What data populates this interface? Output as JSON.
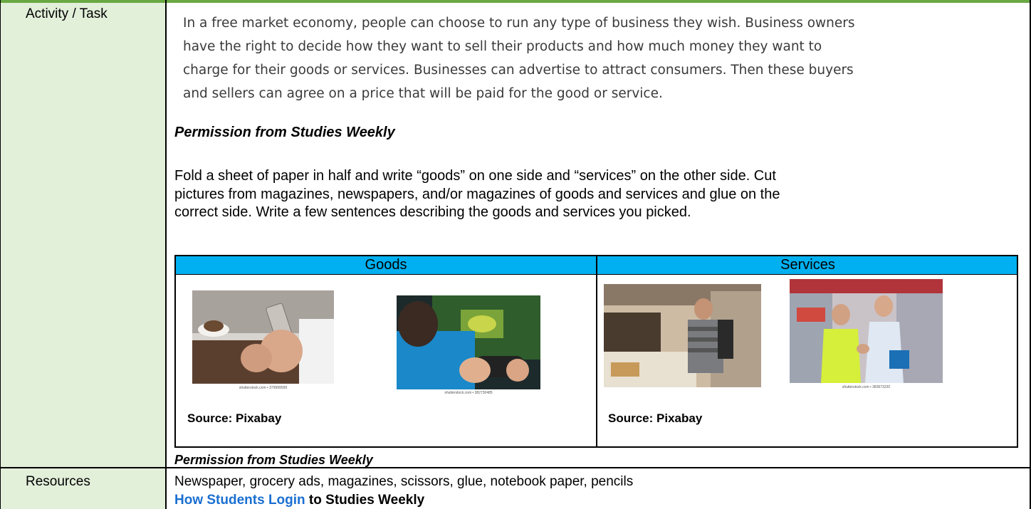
{
  "labels": {
    "activity": "Activity / Task",
    "resources": "Resources"
  },
  "passage": {
    "lines": [
      "In a free market economy, people can choose to run any type of business they wish. Business owners",
      "have the right to decide how they want to sell their products and how much money they want to",
      "charge for their goods or services. Businesses can advertise to attract consumers. Then these buyers",
      "and sellers can agree on a price that will be paid for the good or service."
    ]
  },
  "permission": "Permission from Studies Weekly",
  "instructions": {
    "lines": [
      "Fold a sheet of paper in half and write “goods” on one side and “services” on the other side. Cut",
      "pictures from magazines, newspapers, and/or magazines of goods and services and glue on the",
      "correct side. Write a few sentences describing the goods and services you picked."
    ]
  },
  "table": {
    "headers": [
      "Goods",
      "Services"
    ],
    "source_text": "Source: Pixabay",
    "captions": [
      "shutterstock.com • 379999599",
      "shutterstock.com • 382730485",
      "shutterstock.com • 383673220"
    ]
  },
  "resources_text": "Newspaper, grocery ads, magazines, scissors, glue, notebook paper, pencils",
  "login": {
    "link_text": "How Students Login",
    "rest_text": " to Studies Weekly"
  },
  "colors": {
    "header_band": "#6aa842",
    "left_column": "#e2efd9",
    "table_header": "#00b0f0",
    "link": "#1a6fd1"
  }
}
